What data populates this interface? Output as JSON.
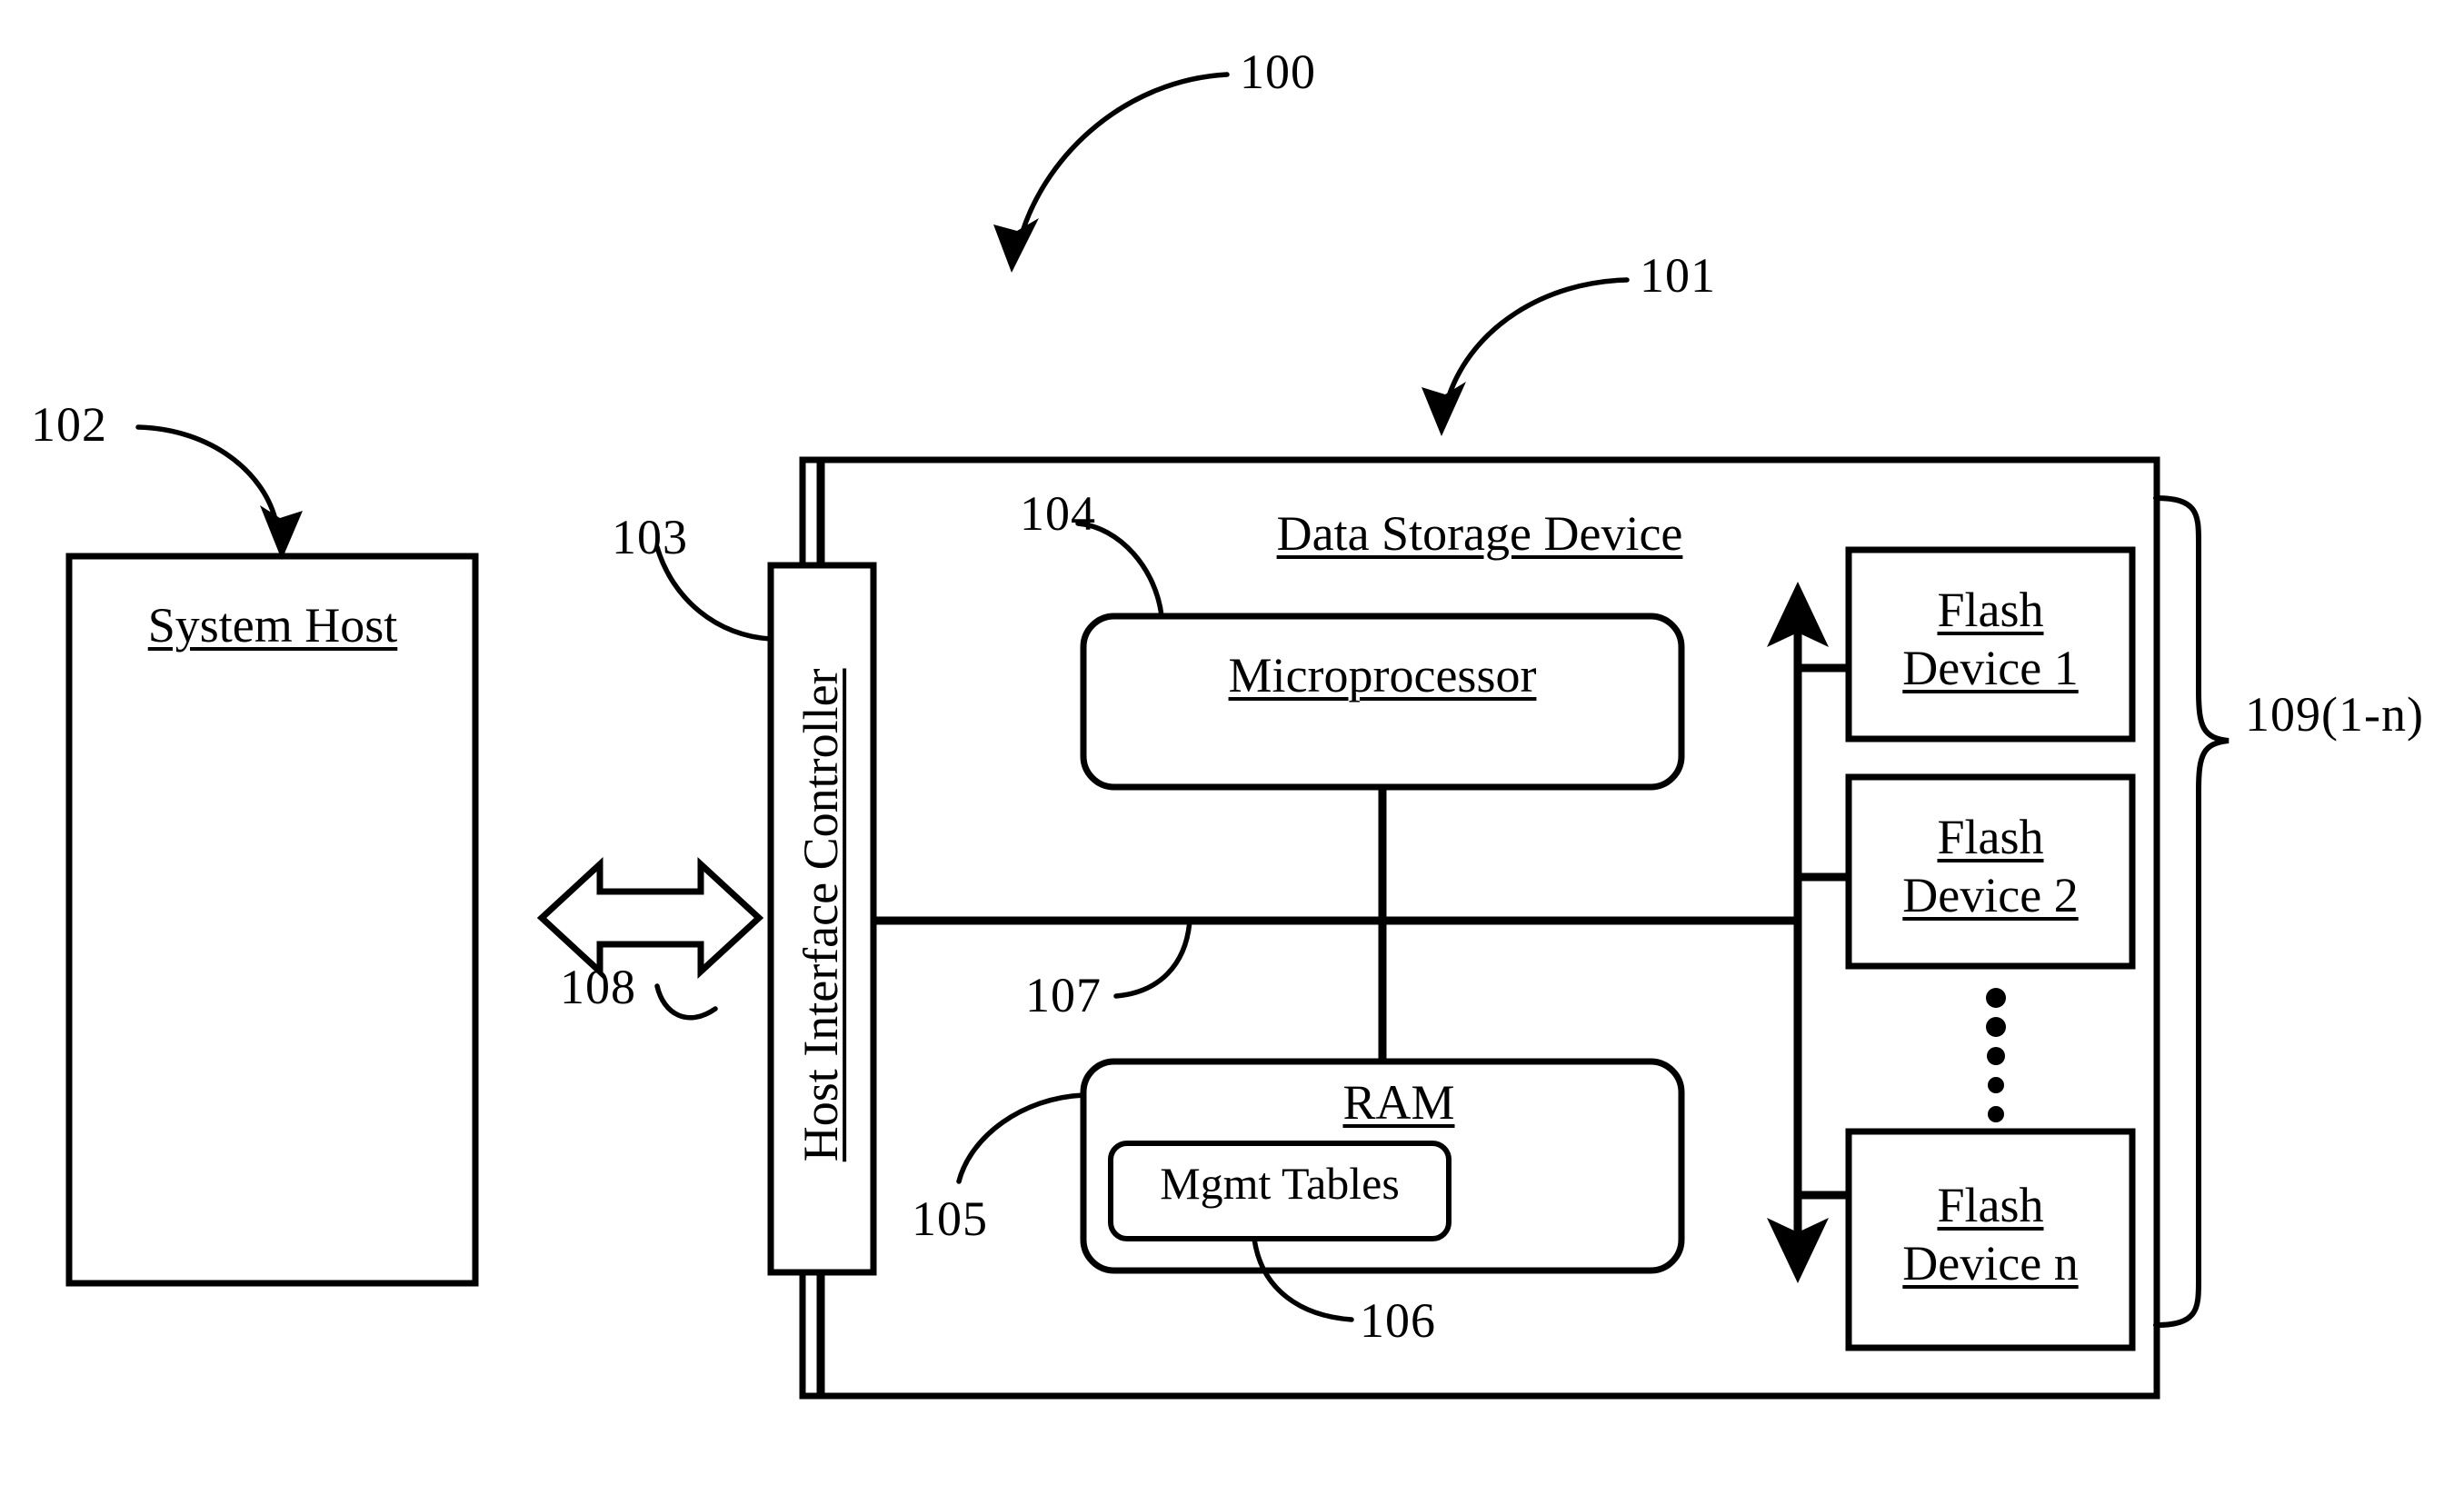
{
  "figure": {
    "type": "patent-block-diagram",
    "title_ref": "100"
  },
  "reference_numerals": {
    "system_overview": "100",
    "data_storage_device": "101",
    "system_host": "102",
    "host_interface_controller": "103",
    "microprocessor": "104",
    "ram": "105",
    "mgmt_tables": "106",
    "internal_bus": "107",
    "host_link": "108",
    "flash_devices_group": "109(1-n)"
  },
  "blocks": {
    "system_host": {
      "label": "System Host",
      "underlined": true
    },
    "host_interface_controller": {
      "label": "Host Interface Controller",
      "underlined": true,
      "orientation": "vertical"
    },
    "data_storage_device": {
      "label": "Data Storage Device",
      "underlined": true
    },
    "microprocessor": {
      "label": "Microprocessor",
      "underlined": true
    },
    "ram": {
      "label": "RAM",
      "underlined": true
    },
    "mgmt_tables": {
      "label": "Mgmt Tables",
      "underlined": false
    },
    "flash_devices": [
      {
        "line1": "Flash",
        "line2": "Device 1",
        "underlined": true
      },
      {
        "line1": "Flash",
        "line2": "Device 2",
        "underlined": true
      },
      {
        "line1": "Flash",
        "line2": "Device n",
        "underlined": true
      }
    ],
    "ellipsis_dots": 5
  },
  "colors": {
    "stroke": "#000000",
    "fill": "#ffffff",
    "text": "#000000"
  }
}
